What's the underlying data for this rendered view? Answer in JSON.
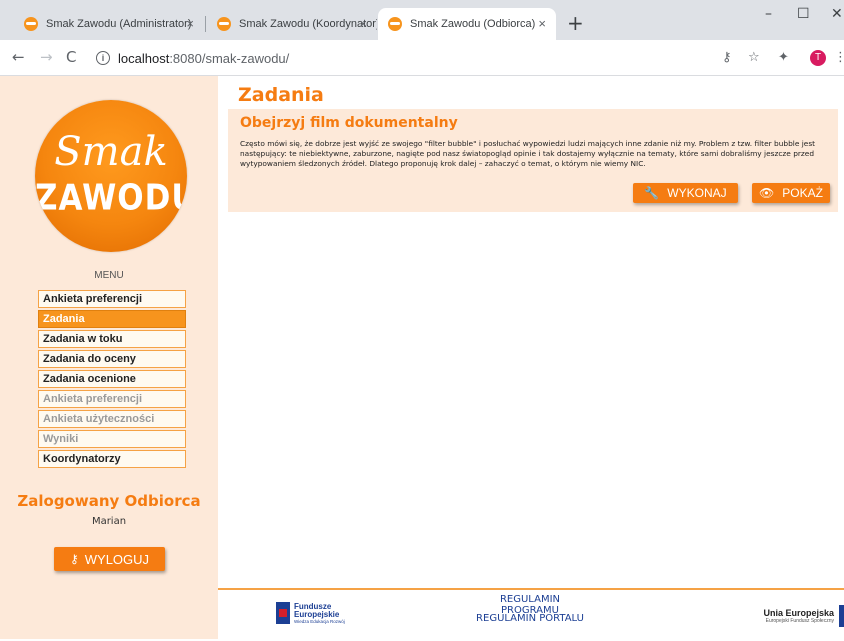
{
  "browser": {
    "tabs": [
      {
        "title": "Smak Zawodu (Administrator)",
        "active": false
      },
      {
        "title": "Smak Zawodu (Koordynator)",
        "active": false
      },
      {
        "title": "Smak Zawodu (Odbiorca)",
        "active": true
      }
    ],
    "new_tab": "+",
    "close_glyph": "×",
    "url_host": "localhost",
    "url_path": ":8080/smak-zawodu/",
    "profile_initial": "T",
    "window_controls": [
      "–",
      "☐",
      "✕"
    ]
  },
  "sidebar": {
    "logo_line1": "Smak",
    "logo_line2": "ZAWODU",
    "menu_label": "MENU",
    "items": [
      {
        "label": "Ankieta preferencji",
        "state": "normal"
      },
      {
        "label": "Zadania",
        "state": "active"
      },
      {
        "label": "Zadania w toku",
        "state": "normal"
      },
      {
        "label": "Zadania do oceny",
        "state": "normal"
      },
      {
        "label": "Zadania ocenione",
        "state": "normal"
      },
      {
        "label": "Ankieta preferencji",
        "state": "disabled"
      },
      {
        "label": "Ankieta użyteczności",
        "state": "disabled"
      },
      {
        "label": "Wyniki",
        "state": "disabled"
      },
      {
        "label": "Koordynatorzy",
        "state": "normal"
      }
    ],
    "logged_label": "Zalogowany Odbiorca",
    "user_name": "Marian",
    "logout_label": "WYLOGUJ"
  },
  "main": {
    "title": "Zadania",
    "task": {
      "title": "Obejrzyj film dokumentalny",
      "description": "Często mówi się, że dobrze jest wyjść ze swojego \"filter bubble\" i posłuchać wypowiedzi ludzi mających inne zdanie niż my. Problem z tzw. filter bubble jest następujący: te niebiektywne, zaburzone, nagięte pod nasz światopogląd opinie i tak dostajemy wyłącznie na tematy, które sami dobraliśmy jeszcze przed wytypowaniem śledzonych źródeł. Dlatego proponuję krok dalej – zahaczyć o temat, o którym nie wiemy NIC.",
      "execute_label": "WYKONAJ",
      "show_label": "POKAŻ"
    }
  },
  "footer": {
    "eu_fund_line1": "Fundusze",
    "eu_fund_line2": "Europejskie",
    "eu_fund_sub": "Wiedza Edukacja Rozwój",
    "regulamin_programu": "REGULAMIN PROGRAMU",
    "regulamin_portalu": "REGULAMIN PORTALU",
    "eu_union": "Unia Europejska",
    "eu_union_sub": "Europejski Fundusz Społeczny"
  },
  "colors": {
    "accent": "#f57c12",
    "sidebar_bg": "#fde9d9",
    "link": "#1c3f94"
  }
}
